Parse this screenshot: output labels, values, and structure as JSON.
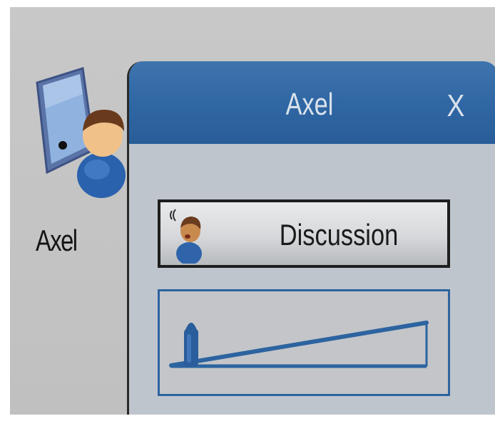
{
  "desktop": {
    "icon_name": "user-monitor-icon",
    "label": "Axel"
  },
  "popup": {
    "title": "Axel",
    "close_label": "X",
    "discussion_button": {
      "label": "Discussion",
      "icon": "speaking-person-icon"
    },
    "volume_slider": {
      "icon": "volume-ramp-icon",
      "level": 0.1
    }
  },
  "colors": {
    "title_bar": "#2f66a3",
    "panel_bg": "#bfc5cd",
    "desktop_bg": "#c4c4c4",
    "slider_blue": "#2c64a0"
  }
}
